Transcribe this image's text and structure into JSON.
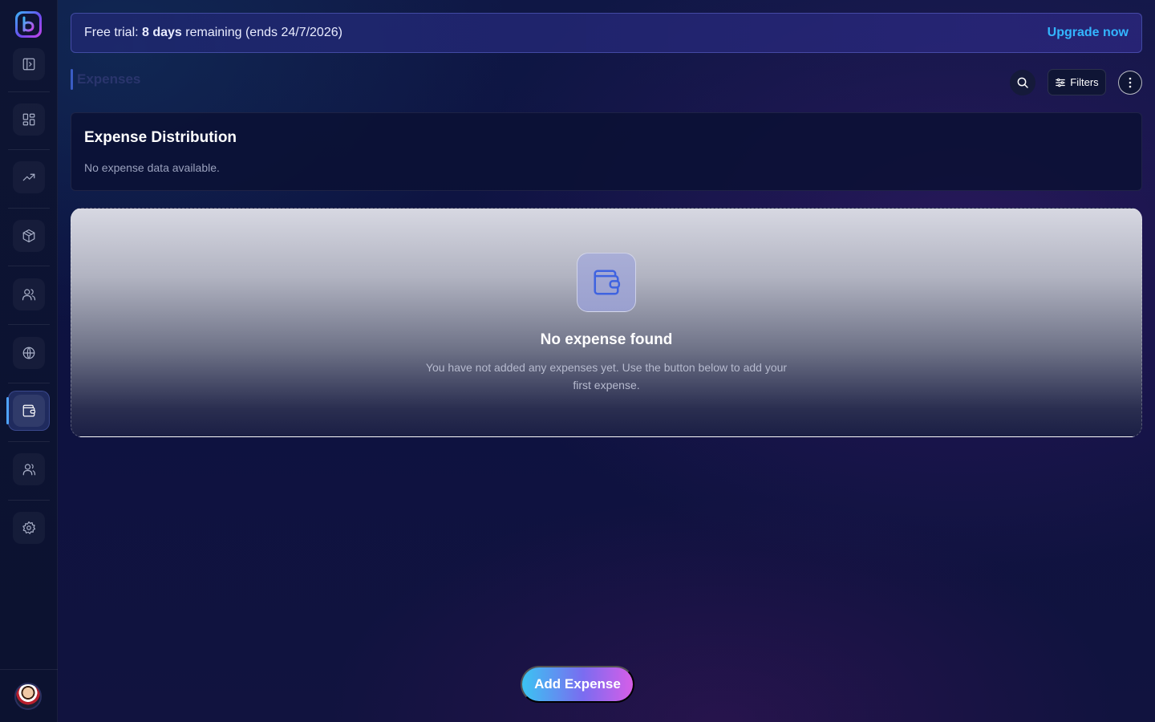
{
  "app": {
    "name": "b"
  },
  "sidebar": {
    "items": [
      {
        "icon": "dashboard-icon"
      },
      {
        "icon": "trending-up-icon"
      },
      {
        "icon": "package-icon"
      },
      {
        "icon": "users-icon"
      },
      {
        "icon": "globe-icon"
      },
      {
        "icon": "wallet-icon",
        "active": true
      },
      {
        "icon": "team-icon"
      },
      {
        "icon": "gear-icon"
      }
    ]
  },
  "trial": {
    "prefix": "Free trial: ",
    "days": "8 days",
    "suffix": " remaining (ends 24/7/2026)",
    "upgrade_label": "Upgrade now"
  },
  "header": {
    "title": "Expenses",
    "filters_label": "Filters"
  },
  "distribution": {
    "title": "Expense Distribution",
    "empty_text": "No expense data available."
  },
  "empty_state": {
    "title": "No expense found",
    "description": "You have not added any expenses yet. Use the button below to add your first expense."
  },
  "actions": {
    "add_label": "Add Expense"
  },
  "colors": {
    "accent": "#33b6ff",
    "active_indicator": "#4fa3ff",
    "button_gradient_start": "#3bc4f2",
    "button_gradient_end": "#d65ee8"
  }
}
